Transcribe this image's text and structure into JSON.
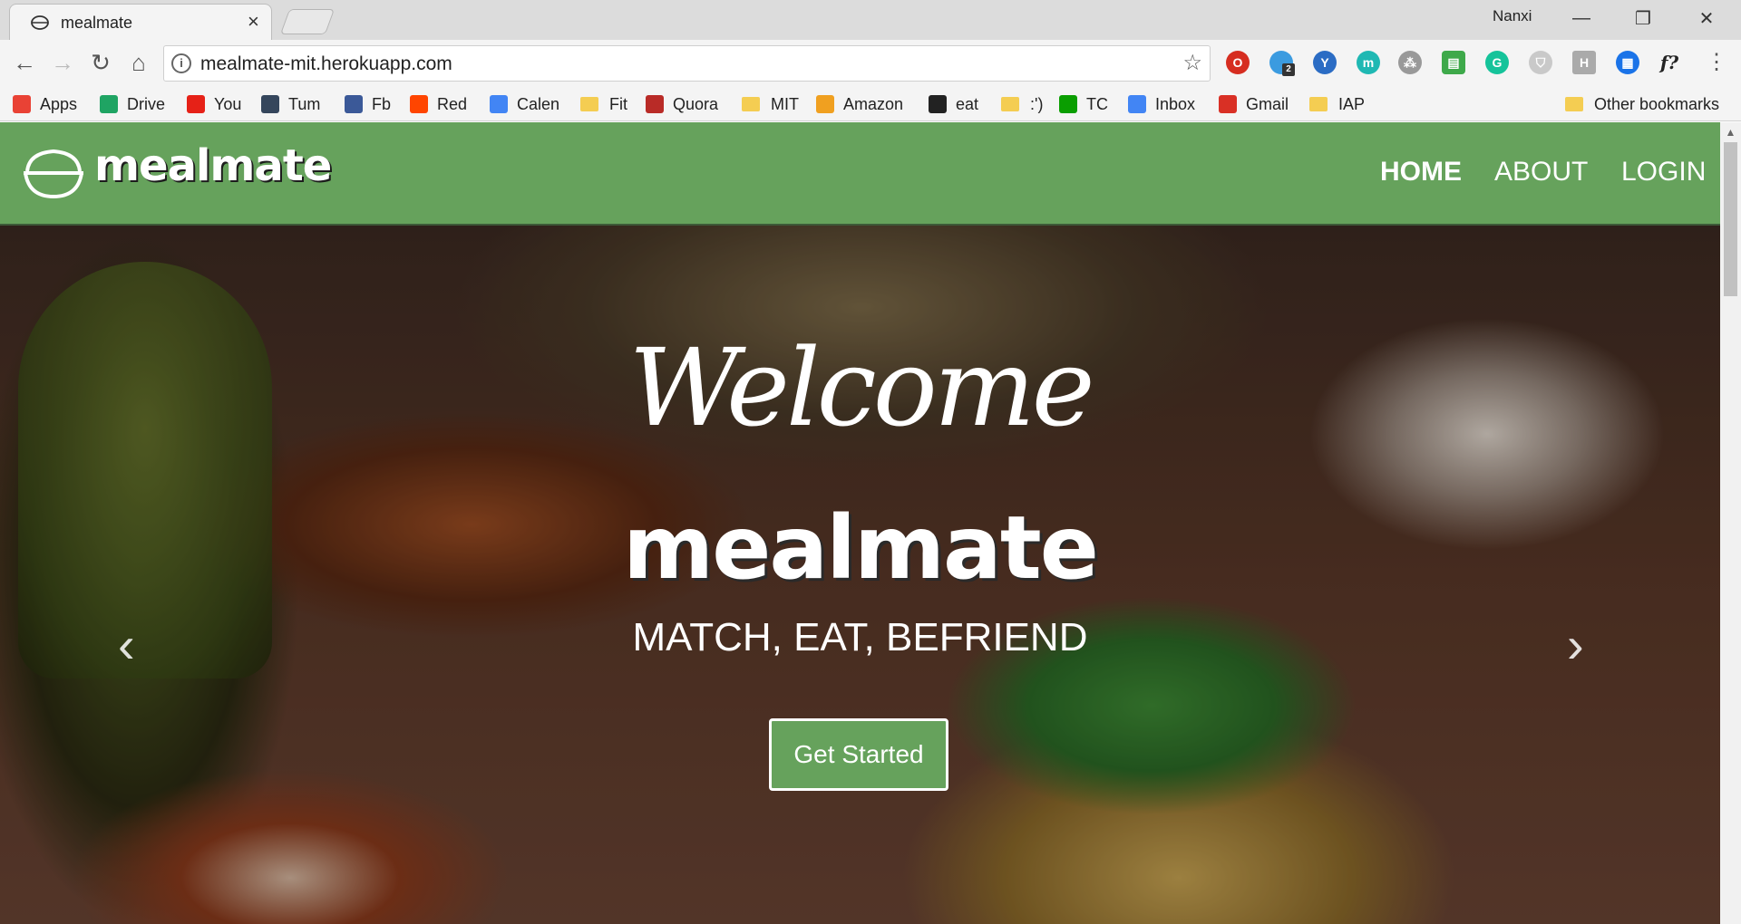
{
  "browser": {
    "tab_title": "mealmate",
    "tab_close": "×",
    "profile_name": "Nanxi",
    "url": "mealmate-mit.herokuapp.com",
    "bookmarks": [
      {
        "label": "Apps",
        "icon": "apps-grid-icon"
      },
      {
        "label": "Drive",
        "icon": "drive-icon"
      },
      {
        "label": "You",
        "icon": "youtube-icon"
      },
      {
        "label": "Tum",
        "icon": "tumblr-icon"
      },
      {
        "label": "Fb",
        "icon": "facebook-icon"
      },
      {
        "label": "Red",
        "icon": "reddit-icon"
      },
      {
        "label": "Calen",
        "icon": "calendar-icon"
      },
      {
        "label": "Fit",
        "icon": "folder-icon"
      },
      {
        "label": "Quora",
        "icon": "quora-icon"
      },
      {
        "label": "MIT",
        "icon": "folder-icon"
      },
      {
        "label": "Amazon",
        "icon": "amazon-icon"
      },
      {
        "label": "eat",
        "icon": "fork-knife-icon"
      },
      {
        "label": ":')",
        "icon": "folder-icon"
      },
      {
        "label": "TC",
        "icon": "techcrunch-icon"
      },
      {
        "label": "Inbox",
        "icon": "inbox-icon"
      },
      {
        "label": "Gmail",
        "icon": "gmail-icon"
      },
      {
        "label": "IAP",
        "icon": "folder-icon"
      }
    ],
    "other_bookmarks": "Other bookmarks",
    "extension_badge": "2",
    "extension_text_h": "H",
    "extension_text_f": "f?"
  },
  "site": {
    "brand": "mealmate",
    "nav": {
      "home": "HOME",
      "about": "ABOUT",
      "login": "LOGIN"
    },
    "hero": {
      "welcome": "Welcome",
      "brand": "mealmate",
      "tagline": "MATCH, EAT, BEFRIEND",
      "cta": "Get Started",
      "prev_arrow": "‹",
      "next_arrow": "›"
    },
    "colors": {
      "nav_bg": "#66a25c",
      "button_bg": "#66a25c"
    }
  }
}
